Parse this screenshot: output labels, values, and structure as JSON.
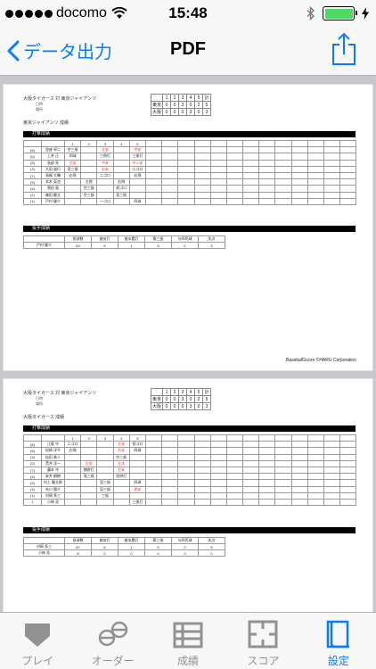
{
  "status": {
    "carrier": "docomo",
    "time": "15:48"
  },
  "nav": {
    "back_label": "データ出力",
    "title": "PDF"
  },
  "pages": [
    {
      "title": "大阪タイガース 対 東京ジャイアンツ",
      "meta1": "日時",
      "meta2": "場所",
      "subtitle": "東京ジャイアンツ 成績",
      "score": {
        "header": [
          "1",
          "2",
          "3",
          "4",
          "5",
          "計"
        ],
        "rows": [
          {
            "team": "東京",
            "cells": [
              "0",
              "0",
              "3",
              "0",
              "2",
              "5"
            ]
          },
          {
            "team": "大阪",
            "cells": [
              "0",
              "0",
              "0",
              "3",
              "0",
              "3"
            ]
          }
        ]
      },
      "batting_label": "打撃成績",
      "batting_header": [
        "",
        "",
        "1",
        "2",
        "3",
        "4",
        "5"
      ],
      "batting_rows": [
        [
          "(8)",
          "並座 卓二",
          "空三振",
          "",
          "左安",
          "",
          "中安"
        ],
        [
          "(6)",
          "上井 正",
          "四球",
          "",
          "三飛打",
          "",
          "三振打"
        ],
        [
          "(5)",
          "長部 亮",
          "左安",
          "",
          "中安",
          "",
          "中二安"
        ],
        [
          "(3)",
          "大田 道行",
          "見三振",
          "",
          "右安",
          "",
          "二ゴロ"
        ],
        [
          "(7)",
          "長嶋 大輔",
          "右飛",
          "",
          "二ゴロ",
          "",
          "右飛"
        ],
        [
          "(9)",
          "本木 英也",
          "",
          "左飛",
          "",
          "右飛",
          ""
        ],
        [
          "(4)",
          "黒田 晃",
          "",
          "空三振",
          "",
          "遊ゴロ",
          ""
        ],
        [
          "(2)",
          "森田 慶太",
          "",
          "空三振",
          "",
          "見三振",
          ""
        ],
        [
          "(1)",
          "戸村 健介",
          "",
          "",
          "一ゴロ",
          "",
          "四球"
        ]
      ],
      "pitching_label": "投手成績",
      "pitching_header": [
        "",
        "投球数",
        "被安打",
        "被本塁打",
        "奪三振",
        "与四死球",
        "失点"
      ],
      "pitching_rows": [
        [
          "戸村 健介",
          "64",
          "6",
          "1",
          "5",
          "2",
          "3"
        ]
      ],
      "copyright": "BaseballScore ©HARU Corporation"
    },
    {
      "title": "大阪タイガース 対 東京ジャイアンツ",
      "meta1": "日時",
      "meta2": "場所",
      "subtitle": "大阪タイガース 成績",
      "score": {
        "header": [
          "1",
          "2",
          "3",
          "4",
          "5",
          "計"
        ],
        "rows": [
          {
            "team": "東京",
            "cells": [
              "0",
              "0",
              "3",
              "0",
              "2",
              "5"
            ]
          },
          {
            "team": "大阪",
            "cells": [
              "0",
              "0",
              "0",
              "3",
              "0",
              "3"
            ]
          }
        ]
      },
      "batting_label": "打撃成績",
      "batting_header": [
        "",
        "",
        "1",
        "2",
        "3",
        "4",
        "5"
      ],
      "batting_rows": [
        [
          "(8)",
          "江夏 守",
          "二ゴロ",
          "",
          "",
          "左安",
          "投ゴロ"
        ],
        [
          "(6)",
          "松崎 洋平",
          "右飛",
          "",
          "",
          "右安",
          "四球"
        ],
        [
          "(3)",
          "松田 勇人",
          "",
          "",
          "",
          "空三振",
          ""
        ],
        [
          "(2)",
          "荒井 洋一",
          "",
          "左安",
          "",
          "左本",
          ""
        ],
        [
          "(7)",
          "藤本 守",
          "",
          "捕併打",
          "",
          "右安",
          ""
        ],
        [
          "(9)",
          "安井 鋼樹",
          "",
          "見三振",
          "",
          "投併打",
          ""
        ],
        [
          "(5)",
          "村上 龍太郎",
          "",
          "",
          "見三振",
          "",
          "四球"
        ],
        [
          "(4)",
          "糸川 陽介",
          "",
          "",
          "見三振",
          "",
          "遊安"
        ],
        [
          "(1)",
          "村岡 多三",
          "",
          "",
          "三振",
          "",
          ""
        ],
        [
          "1",
          "小林 浩",
          "",
          "",
          "",
          "",
          "三振打"
        ]
      ],
      "pitching_label": "投手成績",
      "pitching_header": [
        "",
        "投球数",
        "被安打",
        "被本塁打",
        "奪三振",
        "与四死球",
        "失点"
      ],
      "pitching_rows": [
        [
          "村岡 多三",
          "87",
          "6",
          "1",
          "5",
          "2",
          "5"
        ],
        [
          "小林 浩",
          "8",
          "0",
          "0",
          "0",
          "0",
          "0"
        ]
      ]
    }
  ],
  "tabs": [
    {
      "label": "プレイ",
      "icon": "home-plate-icon"
    },
    {
      "label": "オーダー",
      "icon": "order-icon"
    },
    {
      "label": "成績",
      "icon": "table-icon"
    },
    {
      "label": "スコア",
      "icon": "scoreboard-icon"
    },
    {
      "label": "設定",
      "icon": "settings-icon",
      "active": true
    }
  ],
  "colors": {
    "accent": "#0a7aff",
    "hit": "#e33333",
    "battery": "#4cd964"
  }
}
